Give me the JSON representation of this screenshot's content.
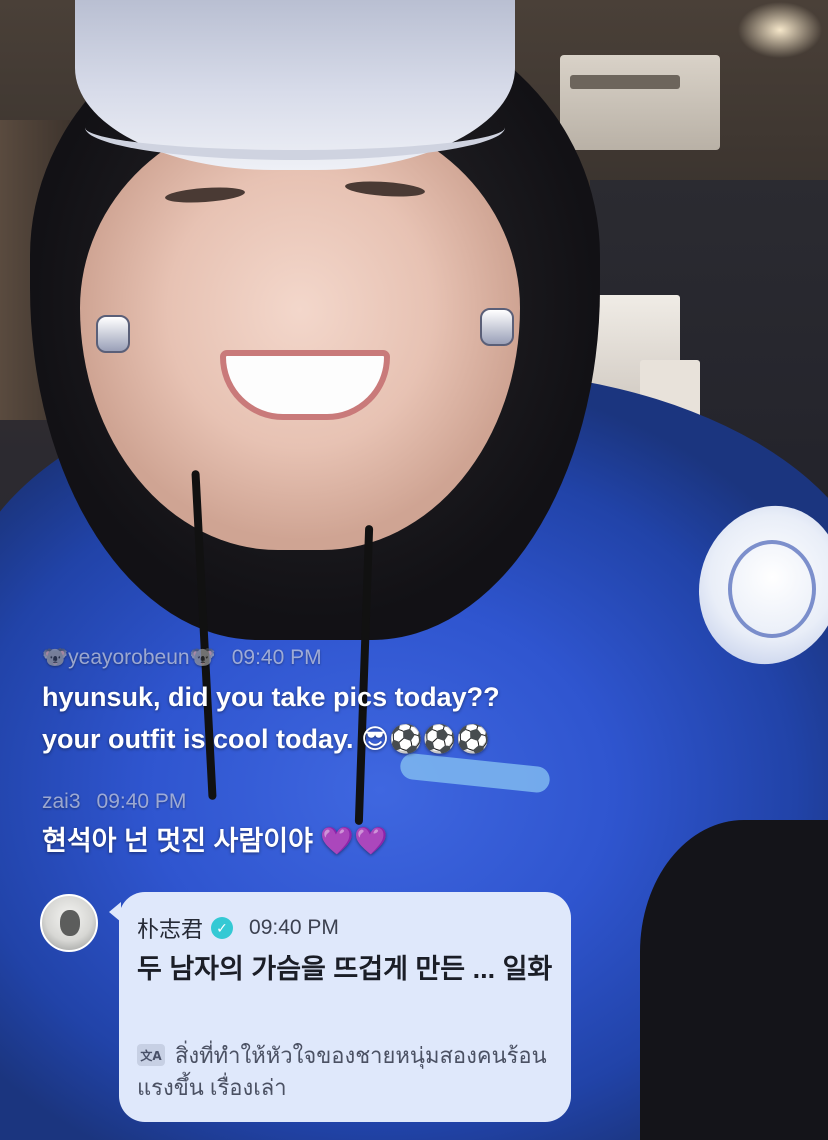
{
  "chat": {
    "messages": [
      {
        "username": "🐨yeayorobeun🐨",
        "time": "09:40 PM",
        "lines": [
          "hyunsuk, did you take pics today??",
          "your outfit is cool today. 😎⚽⚽⚽"
        ]
      },
      {
        "username": "zai3",
        "time": "09:40 PM",
        "lines": [
          "현석아 넌 멋진 사람이야 💜💜"
        ]
      }
    ],
    "artist_message": {
      "username": "朴志君",
      "time": "09:40 PM",
      "text": "두 남자의 가슴을 뜨겁게 만든 ... 일화",
      "translation": "สิ่งที่ทำให้หัวใจของชายหนุ่มสองคนร้อนแรงขึ้น เรื่องเล่า",
      "translate_icon_label": "文A"
    }
  },
  "colors": {
    "bubble_bg": "#dfe8fb",
    "verified": "#34c9d4"
  },
  "icons": {
    "verified": "verified-check-icon",
    "translate": "translate-icon"
  }
}
